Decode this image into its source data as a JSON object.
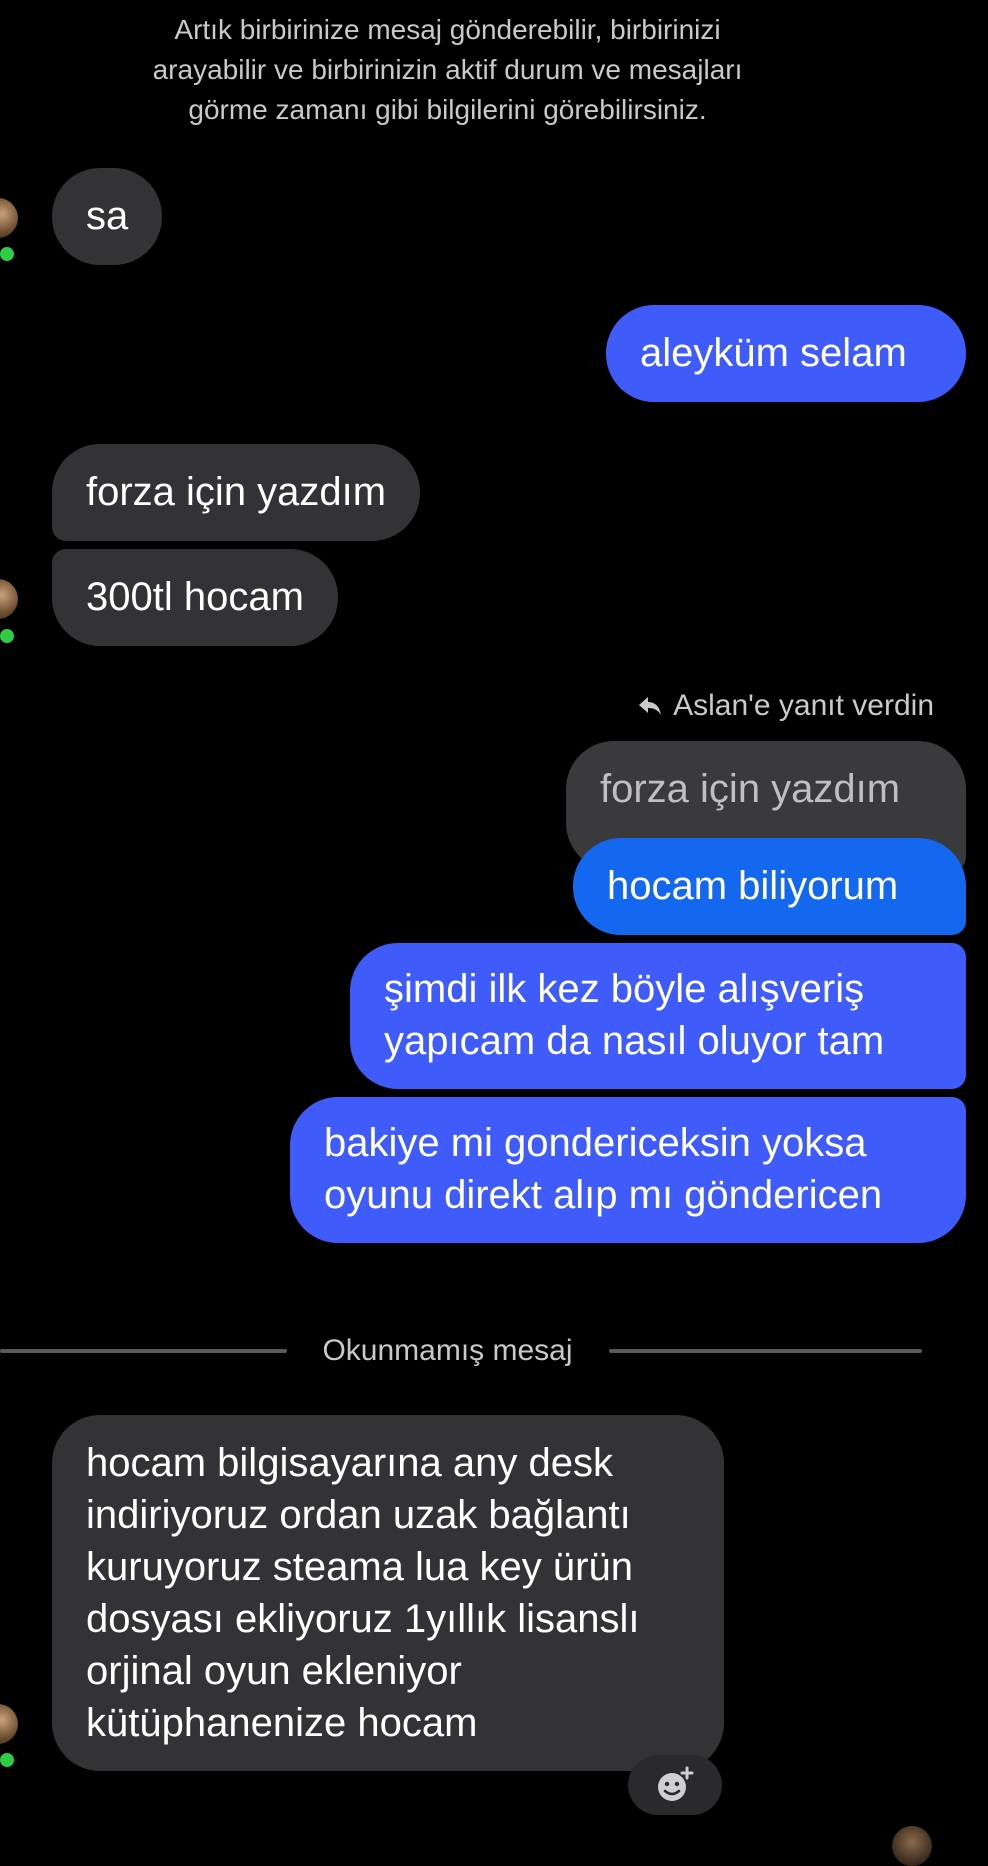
{
  "system_notice": {
    "lines": [
      "Artık birbirinize mesaj gönderebilir, birbirinizi",
      "arayabilir ve birbirinizin aktif durum ve mesajları",
      "görme zamanı gibi bilgilerini görebilirsiniz."
    ]
  },
  "messages": {
    "m1": "sa",
    "m2": "aleyküm selam",
    "m3": "forza için yazdım",
    "m4": "300tl hocam",
    "reply_label": "Aslan'e yanıt verdin",
    "quoted": "forza için yazdım",
    "m5": "hocam biliyorum",
    "m6": [
      "şimdi ilk kez böyle alışveriş",
      "yapıcam da nasıl oluyor tam"
    ],
    "m7": [
      "bakiye mi gondericeksin yoksa",
      "oyunu direkt alıp mı göndericen"
    ],
    "m8": [
      "hocam bilgisayarına any desk",
      "indiriyoruz ordan uzak bağlantı",
      "kuruyoruz steama lua key ürün",
      "dosyası ekliyoruz 1yıllık lisanslı",
      "orjinal oyun ekleniyor",
      "kütüphanenize hocam"
    ]
  },
  "divider": {
    "label": "Okunmamış mesaj"
  },
  "icons": {
    "reply": "reply-arrow-icon",
    "add_reaction": "add-reaction-icon",
    "presence": "online-dot"
  },
  "colors": {
    "background": "#000000",
    "incoming_bubble": "#333335",
    "outgoing_bubble": "#3f5cfb",
    "outgoing_bubble_accent": "#1468f0",
    "presence": "#31cc46"
  }
}
